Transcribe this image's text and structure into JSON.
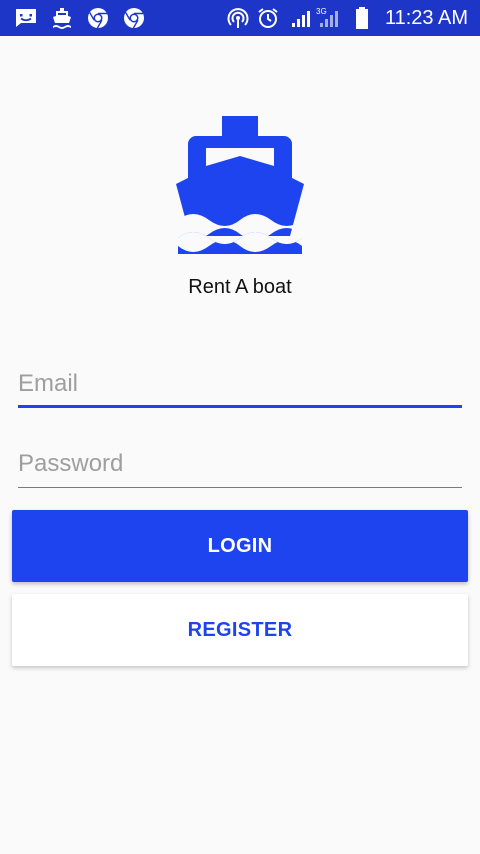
{
  "status_bar": {
    "time": "11:23 AM",
    "network": "3G",
    "left_icons": [
      "message-icon",
      "boat-icon",
      "chrome-icon",
      "chrome-icon"
    ],
    "right_icons": [
      "hotspot-icon",
      "alarm-icon",
      "signal-icon",
      "signal-3g-icon",
      "battery-icon"
    ]
  },
  "colors": {
    "status_bar": "#1e36c8",
    "accent": "#1e44f0",
    "background": "#fafafa"
  },
  "app": {
    "logo_icon": "boat-icon",
    "name": "Rent A boat"
  },
  "form": {
    "email_placeholder": "Email",
    "email_value": "",
    "password_placeholder": "Password",
    "password_value": ""
  },
  "buttons": {
    "login_label": "LOGIN",
    "register_label": "REGISTER"
  }
}
